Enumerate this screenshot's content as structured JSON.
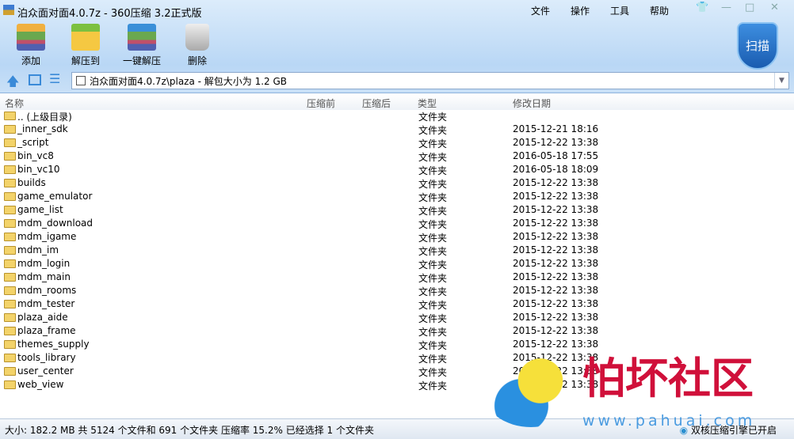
{
  "window": {
    "title": "泊众面对面4.0.7z - 360压缩 3.2正式版",
    "menu": [
      "文件",
      "操作",
      "工具",
      "帮助"
    ]
  },
  "toolbar": {
    "add": "添加",
    "extract_to": "解压到",
    "one_click": "一键解压",
    "delete": "删除",
    "scan": "扫描"
  },
  "address": {
    "value": "泊众面对面4.0.7z\\plaza - 解包大小为 1.2 GB"
  },
  "columns": [
    "名称",
    "压缩前",
    "压缩后",
    "类型",
    "修改日期"
  ],
  "rows": [
    {
      "name": ".. (上级目录)",
      "type": "文件夹",
      "date": ""
    },
    {
      "name": "_inner_sdk",
      "type": "文件夹",
      "date": "2015-12-21 18:16"
    },
    {
      "name": "_script",
      "type": "文件夹",
      "date": "2015-12-22 13:38"
    },
    {
      "name": "bin_vc8",
      "type": "文件夹",
      "date": "2016-05-18 17:55"
    },
    {
      "name": "bin_vc10",
      "type": "文件夹",
      "date": "2016-05-18 18:09"
    },
    {
      "name": "builds",
      "type": "文件夹",
      "date": "2015-12-22 13:38"
    },
    {
      "name": "game_emulator",
      "type": "文件夹",
      "date": "2015-12-22 13:38"
    },
    {
      "name": "game_list",
      "type": "文件夹",
      "date": "2015-12-22 13:38"
    },
    {
      "name": "mdm_download",
      "type": "文件夹",
      "date": "2015-12-22 13:38"
    },
    {
      "name": "mdm_igame",
      "type": "文件夹",
      "date": "2015-12-22 13:38"
    },
    {
      "name": "mdm_im",
      "type": "文件夹",
      "date": "2015-12-22 13:38"
    },
    {
      "name": "mdm_login",
      "type": "文件夹",
      "date": "2015-12-22 13:38"
    },
    {
      "name": "mdm_main",
      "type": "文件夹",
      "date": "2015-12-22 13:38"
    },
    {
      "name": "mdm_rooms",
      "type": "文件夹",
      "date": "2015-12-22 13:38"
    },
    {
      "name": "mdm_tester",
      "type": "文件夹",
      "date": "2015-12-22 13:38"
    },
    {
      "name": "plaza_aide",
      "type": "文件夹",
      "date": "2015-12-22 13:38"
    },
    {
      "name": "plaza_frame",
      "type": "文件夹",
      "date": "2015-12-22 13:38"
    },
    {
      "name": "themes_supply",
      "type": "文件夹",
      "date": "2015-12-22 13:38"
    },
    {
      "name": "tools_library",
      "type": "文件夹",
      "date": "2015-12-22 13:38"
    },
    {
      "name": "user_center",
      "type": "文件夹",
      "date": "2015-12-22 13:38"
    },
    {
      "name": "web_view",
      "type": "文件夹",
      "date": "2015-12-22 13:38"
    }
  ],
  "status": {
    "summary": "大小: 182.2 MB 共 5124 个文件和 691 个文件夹 压缩率 15.2% 已经选择 1 个文件夹",
    "engine": "双核压缩引擎已开启"
  },
  "watermark": {
    "text": "怕坏社区",
    "url": "www.pahuai.com"
  }
}
